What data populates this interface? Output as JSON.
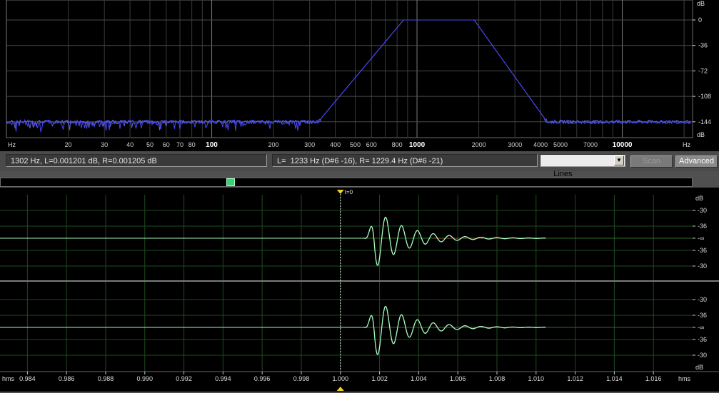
{
  "spectrum": {
    "y_unit": "dB",
    "x_unit": "Hz",
    "db_labels": [
      "0",
      "-36",
      "-72",
      "-108",
      "-144"
    ],
    "freq_labels": [
      "20",
      "30",
      "40",
      "50",
      "60",
      "70",
      "80",
      "100",
      "200",
      "300",
      "400",
      "500",
      "600",
      "800",
      "1000",
      "2000",
      "3000",
      "4000",
      "5000",
      "7000",
      "10000"
    ],
    "curve_color": "#4848ff",
    "passband_hz": [
      860,
      1900
    ],
    "noise_floor_db": -144
  },
  "status": {
    "cursor_readout": "1302 Hz, L=0.001201 dB, R=0.001205 dB",
    "peak_readout": "L=  1233 Hz (D#6 -16), R= 1229.4 Hz (D#6 -21)",
    "display_mode": "Lines",
    "scan_label": "Scan",
    "advanced_label": "Advanced"
  },
  "waveform": {
    "marker_label": "t=0",
    "y_unit": "dB",
    "x_unit": "hms",
    "level_labels": [
      "-30",
      "-36",
      "-∞",
      "-36",
      "-30"
    ],
    "time_labels": [
      "0.984",
      "0.986",
      "0.988",
      "0.990",
      "0.992",
      "0.994",
      "0.996",
      "0.998",
      "1.000",
      "1.002",
      "1.004",
      "1.006",
      "1.008",
      "1.010",
      "1.012",
      "1.014",
      "1.016"
    ],
    "trace_color": "#a8ffc0",
    "grid_color": "#1f4a1f"
  }
}
